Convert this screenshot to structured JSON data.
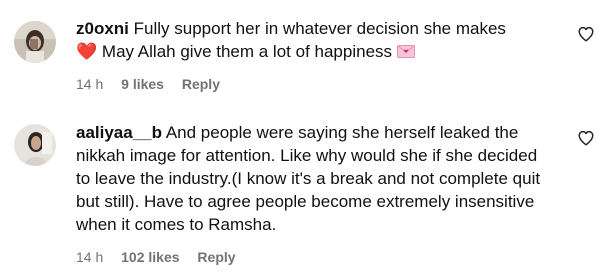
{
  "comments": [
    {
      "username": "z0oxni",
      "line1_text": "Fully support her in whatever decision she makes",
      "line2_heart": "❤️",
      "line2_text": "May Allah give them a lot of happiness",
      "time": "14 h",
      "likes": "9 likes",
      "reply": "Reply",
      "avatar_icon": "profile-photo",
      "like_icon": "heart-outline-icon"
    },
    {
      "username": "aaliyaa__b",
      "text_lines": [
        "And people were saying she herself leaked the",
        "nikkah image for attention. Like why would she if she decided",
        "to leave the industry.(I know it's a break and not complete quit",
        "but still). Have to agree people become extremely insensitive",
        "when it comes to Ramsha."
      ],
      "time": "14 h",
      "likes": "102 likes",
      "reply": "Reply",
      "avatar_icon": "profile-photo",
      "like_icon": "heart-outline-icon"
    }
  ],
  "colors": {
    "meta_text": "#737373",
    "heart_emoji": "#e0245e",
    "letter_emoji": "#f7c4d9"
  }
}
